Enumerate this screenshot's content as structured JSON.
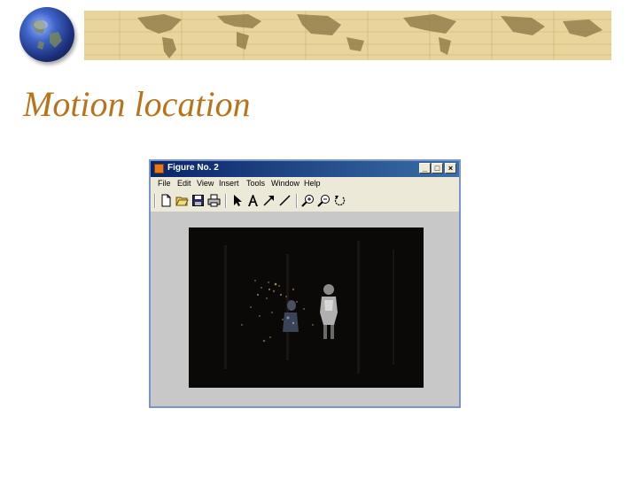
{
  "slide": {
    "title": "Motion location"
  },
  "figure_window": {
    "title": "Figure No. 2",
    "window_buttons": {
      "minimize": "_",
      "maximize": "□",
      "close": "×"
    },
    "menu": [
      "File",
      "Edit",
      "View",
      "Insert",
      "Tools",
      "Window",
      "Help"
    ],
    "toolbar_icons": [
      "new-file-icon",
      "open-folder-icon",
      "save-icon",
      "print-icon",
      "select-arrow-icon",
      "text-icon",
      "arrow-icon",
      "line-icon",
      "zoom-in-icon",
      "zoom-out-icon",
      "rotate-icon"
    ],
    "image": "motion-detection-frame"
  }
}
